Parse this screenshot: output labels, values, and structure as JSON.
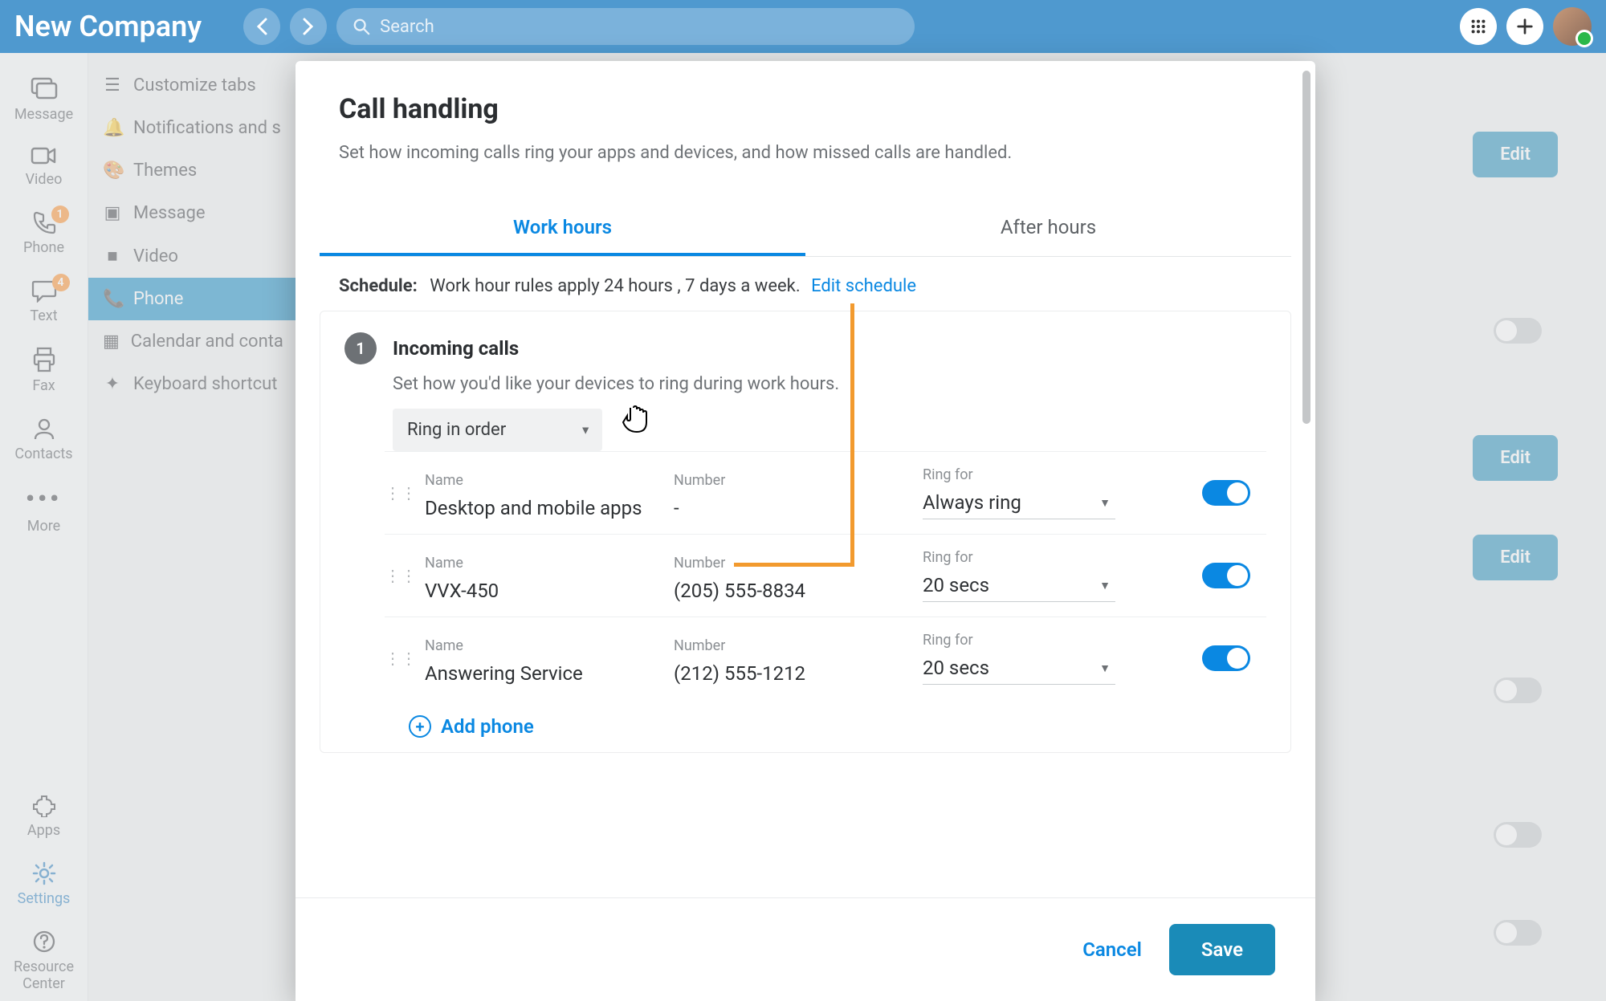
{
  "topbar": {
    "brand": "New Company",
    "search_placeholder": "Search"
  },
  "rail": {
    "items": [
      {
        "label": "Message",
        "icon": "message"
      },
      {
        "label": "Video",
        "icon": "video"
      },
      {
        "label": "Phone",
        "icon": "phone",
        "badge": "1"
      },
      {
        "label": "Text",
        "icon": "text",
        "badge": "4"
      },
      {
        "label": "Fax",
        "icon": "fax"
      },
      {
        "label": "Contacts",
        "icon": "contacts"
      },
      {
        "label": "More",
        "icon": "more"
      }
    ],
    "bottom": [
      {
        "label": "Apps",
        "icon": "apps"
      },
      {
        "label": "Settings",
        "icon": "settings",
        "active": true
      },
      {
        "label": "Resource Center",
        "icon": "help"
      }
    ]
  },
  "subnav": {
    "items": [
      {
        "label": "Customize tabs"
      },
      {
        "label": "Notifications and s"
      },
      {
        "label": "Themes"
      },
      {
        "label": "Message"
      },
      {
        "label": "Video"
      },
      {
        "label": "Phone",
        "active": true
      },
      {
        "label": "Calendar and conta"
      },
      {
        "label": "Keyboard shortcut"
      }
    ]
  },
  "bg": {
    "edit": "Edit"
  },
  "modal": {
    "title": "Call handling",
    "desc": "Set how incoming calls ring your apps and devices, and how missed calls are handled.",
    "tabs": [
      "Work hours",
      "After hours"
    ],
    "schedule_label": "Schedule:",
    "schedule_text": "Work hour rules apply 24 hours , 7 days a week.",
    "schedule_link": "Edit schedule",
    "step_num": "1",
    "step_title": "Incoming calls",
    "step_sub": "Set how you'd like your devices to ring during work hours.",
    "ring_mode": "Ring in order",
    "cols": {
      "name": "Name",
      "number": "Number",
      "ringfor": "Ring for"
    },
    "devices": [
      {
        "name": "Desktop and mobile apps",
        "number": "-",
        "ringfor": "Always ring",
        "on": true
      },
      {
        "name": "VVX-450",
        "number": "(205) 555-8834",
        "ringfor": "20 secs",
        "on": true
      },
      {
        "name": "Answering Service",
        "number": "(212) 555-1212",
        "ringfor": "20 secs",
        "on": true
      }
    ],
    "add_phone": "Add phone",
    "cancel": "Cancel",
    "save": "Save"
  }
}
